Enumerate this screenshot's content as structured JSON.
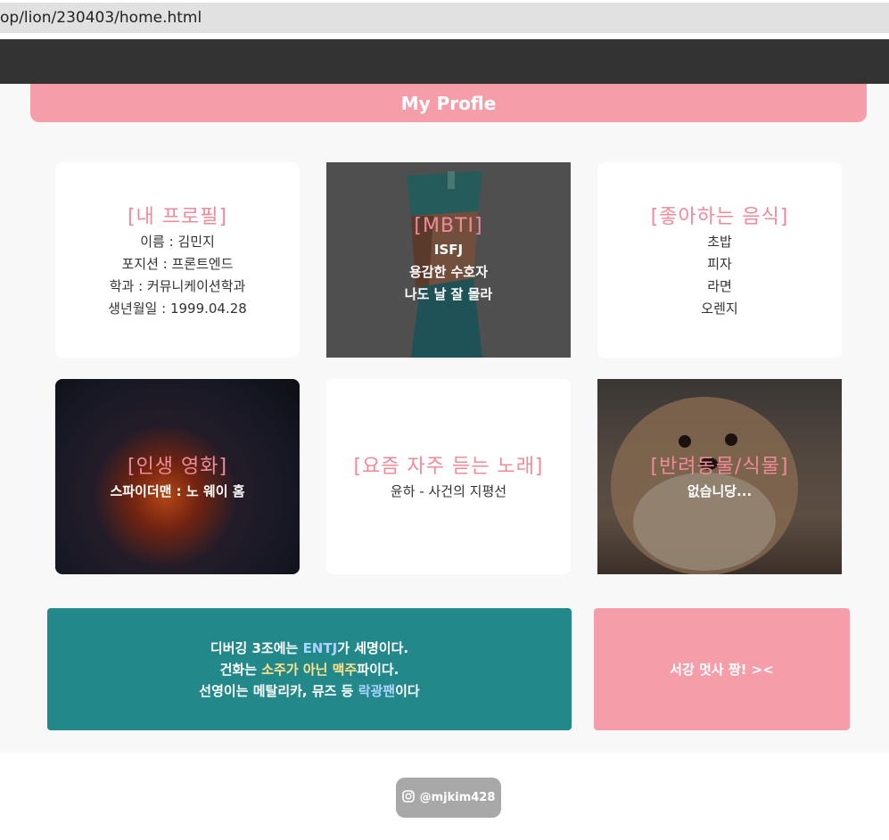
{
  "browser": {
    "url": "op/lion/230403/home.html"
  },
  "header": {
    "title": "My Profle"
  },
  "cards": {
    "profile": {
      "title": "[내 프로필]",
      "lines": [
        "이름 : 김민지",
        "포지션 : 프론트엔드",
        "학과 : 커뮤니케이션학과",
        "생년월일 : 1999.04.28"
      ]
    },
    "mbti": {
      "title": "[MBTI]",
      "lines": [
        "ISFJ",
        "용감한 수호자",
        "나도 날 잘 몰라"
      ]
    },
    "food": {
      "title": "[좋아하는 음식]",
      "lines": [
        "초밥",
        "피자",
        "라면",
        "오렌지"
      ]
    },
    "movie": {
      "title": "[인생 영화]",
      "lines": [
        "스파이더맨 : 노 웨이 홈"
      ]
    },
    "song": {
      "title": "[요즘 자주 듣는 노래]",
      "lines": [
        "윤하 - 사건의 지평선"
      ]
    },
    "pet": {
      "title": "[반려동물/식물]",
      "lines": [
        "없습니당..."
      ]
    }
  },
  "banner_left": {
    "line1_a": "디버깅 3조에는 ",
    "line1_hl": "ENTJ",
    "line1_b": "가 세명이다.",
    "line2_a": "건화는 ",
    "line2_hl1": "소주가 아닌 맥주",
    "line2_b": "파이다.",
    "line3_a": "선영이는 메탈리카, 뮤즈 등 ",
    "line3_hl": "락광팬",
    "line3_b": "이다"
  },
  "banner_right": {
    "text": "서강 멋사 짱! ><"
  },
  "footer": {
    "instagram": "@mjkim428",
    "icon": "instagram-icon"
  },
  "colors": {
    "pink": "#f59eaa",
    "teal": "#23888a",
    "navbar": "#333333"
  }
}
